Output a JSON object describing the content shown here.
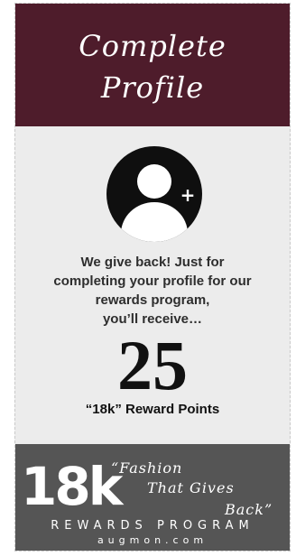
{
  "header": {
    "title_line1": "Complete",
    "title_line2": "Profile"
  },
  "avatar": {
    "icon": "add-user-icon",
    "plus": "+"
  },
  "promo": {
    "lines": [
      "We give back! Just for",
      "completing your profile for our",
      "rewards program,",
      "you’ll receive…"
    ]
  },
  "reward": {
    "points": "25",
    "label": "“18k” Reward Points"
  },
  "footer": {
    "logo": "18k",
    "tagline": [
      "“Fashion",
      "That Gives",
      "Back”"
    ],
    "program": "REWARDS PROGRAM",
    "site": "augmon.com"
  },
  "colors": {
    "header_bg": "#4e1c2b",
    "footer_bg": "#555555",
    "card_bg": "#ececec"
  }
}
